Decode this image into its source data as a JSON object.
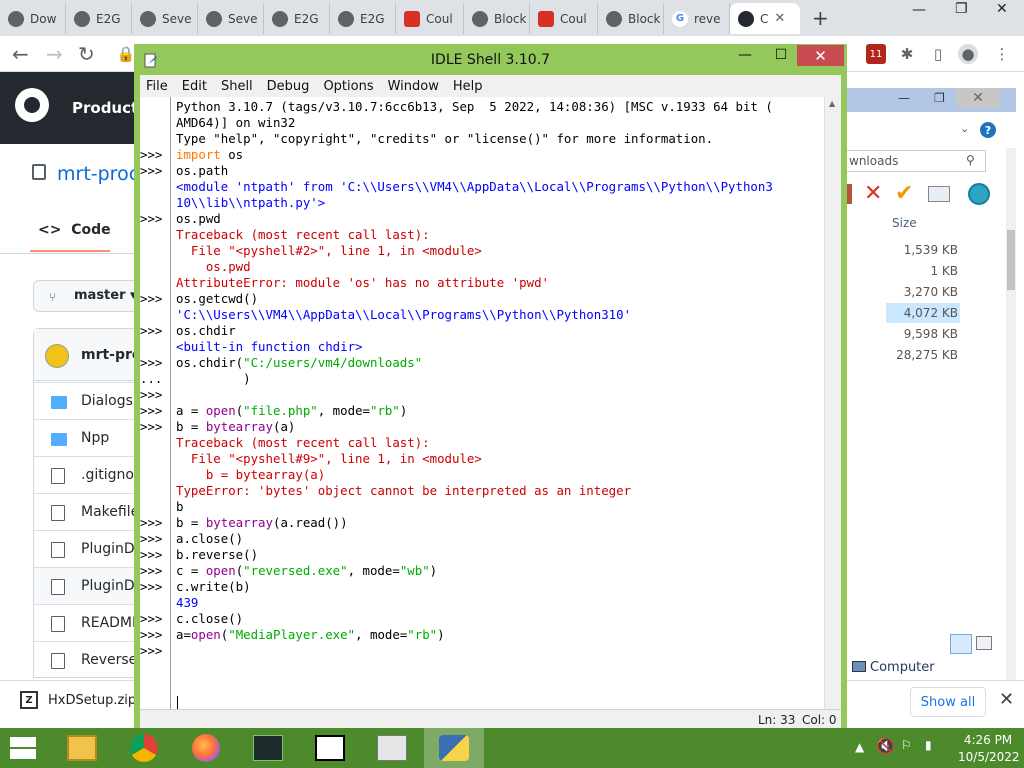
{
  "browser": {
    "tabs": [
      {
        "label": "Dow",
        "icon": "incognito-icon"
      },
      {
        "label": "E2G",
        "icon": "e2g-icon"
      },
      {
        "label": "Seve",
        "icon": "e2g-icon"
      },
      {
        "label": "Seve",
        "icon": "e2g-icon"
      },
      {
        "label": "E2G",
        "icon": "e2g-icon"
      },
      {
        "label": "E2G",
        "icon": "e2g-icon"
      },
      {
        "label": "Coul",
        "icon": "red-square-icon"
      },
      {
        "label": "Block",
        "icon": "e2g-icon"
      },
      {
        "label": "Coul",
        "icon": "red-square-icon"
      },
      {
        "label": "Block",
        "icon": "e2g-icon"
      },
      {
        "label": "reve",
        "icon": "google-icon"
      },
      {
        "label": "C",
        "icon": "github-icon"
      }
    ],
    "notification_badge": "11"
  },
  "github": {
    "nav_product": "Product",
    "repo_name": "mrt-proc",
    "code_tab": "Code",
    "branch": "master",
    "commit_user": "mrt-pro",
    "files": [
      {
        "name": "Dialogs",
        "type": "folder"
      },
      {
        "name": "Npp",
        "type": "folder"
      },
      {
        "name": ".gitignor",
        "type": "file"
      },
      {
        "name": "Makefile",
        "type": "file"
      },
      {
        "name": "PluginD",
        "type": "file"
      },
      {
        "name": "PluginD",
        "type": "file"
      },
      {
        "name": "READMI",
        "type": "file"
      },
      {
        "name": "Reverse",
        "type": "file"
      }
    ]
  },
  "download_bar": {
    "file_name": "HxDSetup.zip",
    "show_all": "Show all"
  },
  "explorer": {
    "search_text": "wnloads",
    "size_header": "Size",
    "sizes": [
      "1,539 KB",
      "1 KB",
      "3,270 KB",
      "4,072 KB",
      "9,598 KB",
      "28,275 KB"
    ],
    "computer_label": "Computer"
  },
  "idle": {
    "title": "IDLE Shell 3.10.7",
    "menu": [
      "File",
      "Edit",
      "Shell",
      "Debug",
      "Options",
      "Window",
      "Help"
    ],
    "lines": [
      {
        "p": "",
        "segs": [
          [
            "",
            "Python 3.10.7 (tags/v3.10.7:6cc6b13, Sep  5 2022, 14:08:36) [MSC v.1933 64 bit ("
          ]
        ]
      },
      {
        "p": "",
        "segs": [
          [
            "",
            "AMD64)] on win32"
          ]
        ]
      },
      {
        "p": "",
        "segs": [
          [
            "",
            "Type \"help\", \"copyright\", \"credits\" or \"license()\" for more information."
          ]
        ]
      },
      {
        "p": ">>>",
        "segs": [
          [
            "kw",
            "import"
          ],
          [
            "",
            " os"
          ]
        ]
      },
      {
        "p": ">>>",
        "segs": [
          [
            "",
            "os.path"
          ]
        ]
      },
      {
        "p": "",
        "segs": [
          [
            "out",
            "<module 'ntpath' from 'C:\\\\Users\\\\VM4\\\\AppData\\\\Local\\\\Programs\\\\Python\\\\Python3"
          ]
        ]
      },
      {
        "p": "",
        "segs": [
          [
            "out",
            "10\\\\lib\\\\ntpath.py'>"
          ]
        ]
      },
      {
        "p": ">>>",
        "segs": [
          [
            "",
            "os.pwd"
          ]
        ]
      },
      {
        "p": "",
        "segs": [
          [
            "err",
            "Traceback (most recent call last):"
          ]
        ]
      },
      {
        "p": "",
        "segs": [
          [
            "err",
            "  File \"<pyshell#2>\", line 1, in <module>"
          ]
        ]
      },
      {
        "p": "",
        "segs": [
          [
            "err",
            "    os.pwd"
          ]
        ]
      },
      {
        "p": "",
        "segs": [
          [
            "err",
            "AttributeError: module 'os' has no attribute 'pwd'"
          ]
        ]
      },
      {
        "p": ">>>",
        "segs": [
          [
            "",
            "os.getcwd()"
          ]
        ]
      },
      {
        "p": "",
        "segs": [
          [
            "out",
            "'C:\\\\Users\\\\VM4\\\\AppData\\\\Local\\\\Programs\\\\Python\\\\Python310'"
          ]
        ]
      },
      {
        "p": ">>>",
        "segs": [
          [
            "",
            "os.chdir"
          ]
        ]
      },
      {
        "p": "",
        "segs": [
          [
            "out",
            "<built-in function chdir>"
          ]
        ]
      },
      {
        "p": ">>>",
        "segs": [
          [
            "",
            "os.chdir("
          ],
          [
            "str",
            "\"C:/users/vm4/downloads\""
          ]
        ]
      },
      {
        "p": "...",
        "segs": [
          [
            "",
            "         )"
          ]
        ]
      },
      {
        "p": ">>>",
        "segs": [
          [
            "",
            ""
          ]
        ]
      },
      {
        "p": ">>>",
        "segs": [
          [
            "",
            "a = "
          ],
          [
            "bi",
            "open"
          ],
          [
            "",
            "("
          ],
          [
            "str",
            "\"file.php\""
          ],
          [
            "",
            ", mode="
          ],
          [
            "str",
            "\"rb\""
          ],
          [
            "",
            ")"
          ]
        ]
      },
      {
        "p": ">>>",
        "segs": [
          [
            "",
            "b = "
          ],
          [
            "bi",
            "bytearray"
          ],
          [
            "",
            "(a)"
          ]
        ]
      },
      {
        "p": "",
        "segs": [
          [
            "err",
            "Traceback (most recent call last):"
          ]
        ]
      },
      {
        "p": "",
        "segs": [
          [
            "err",
            "  File \"<pyshell#9>\", line 1, in <module>"
          ]
        ]
      },
      {
        "p": "",
        "segs": [
          [
            "err",
            "    b = bytearray(a)"
          ]
        ]
      },
      {
        "p": "",
        "segs": [
          [
            "err",
            "TypeError: 'bytes' object cannot be interpreted as an integer"
          ]
        ]
      },
      {
        "p": "",
        "segs": [
          [
            "",
            "b"
          ]
        ]
      },
      {
        "p": ">>>",
        "segs": [
          [
            "",
            "b = "
          ],
          [
            "bi",
            "bytearray"
          ],
          [
            "",
            "(a.read())"
          ]
        ]
      },
      {
        "p": ">>>",
        "segs": [
          [
            "",
            "a.close()"
          ]
        ]
      },
      {
        "p": ">>>",
        "segs": [
          [
            "",
            "b.reverse()"
          ]
        ]
      },
      {
        "p": ">>>",
        "segs": [
          [
            "",
            "c = "
          ],
          [
            "bi",
            "open"
          ],
          [
            "",
            "("
          ],
          [
            "str",
            "\"reversed.exe\""
          ],
          [
            "",
            ", mode="
          ],
          [
            "str",
            "\"wb\""
          ],
          [
            "",
            ")"
          ]
        ]
      },
      {
        "p": ">>>",
        "segs": [
          [
            "",
            "c.write(b)"
          ]
        ]
      },
      {
        "p": "",
        "segs": [
          [
            "out",
            "439"
          ]
        ]
      },
      {
        "p": ">>>",
        "segs": [
          [
            "",
            "c.close()"
          ]
        ]
      },
      {
        "p": ">>>",
        "segs": [
          [
            "",
            "a="
          ],
          [
            "bi",
            "open"
          ],
          [
            "",
            "("
          ],
          [
            "str",
            "\"MediaPlayer.exe\""
          ],
          [
            "",
            ", mode="
          ],
          [
            "str",
            "\"rb\""
          ],
          [
            "",
            ")"
          ]
        ]
      },
      {
        "p": ">>>",
        "segs": [
          [
            "",
            ""
          ]
        ]
      }
    ],
    "status_ln": "Ln: 33",
    "status_col": "Col: 0"
  },
  "taskbar": {
    "apps": [
      "file-explorer-icon",
      "chrome-icon",
      "firefox-icon",
      "activity-monitor-icon",
      "7zip-icon",
      "hxd-icon",
      "python-idle-icon"
    ],
    "time": "4:26 PM",
    "date": "10/5/2022"
  },
  "colors": {
    "idle_frame": "#94c85a",
    "taskbar": "#4d8a2c",
    "idle_keyword": "#ff7700",
    "idle_string": "#00aa00",
    "idle_builtin": "#900090",
    "idle_output": "#0000ff",
    "idle_error": "#cc0000"
  }
}
